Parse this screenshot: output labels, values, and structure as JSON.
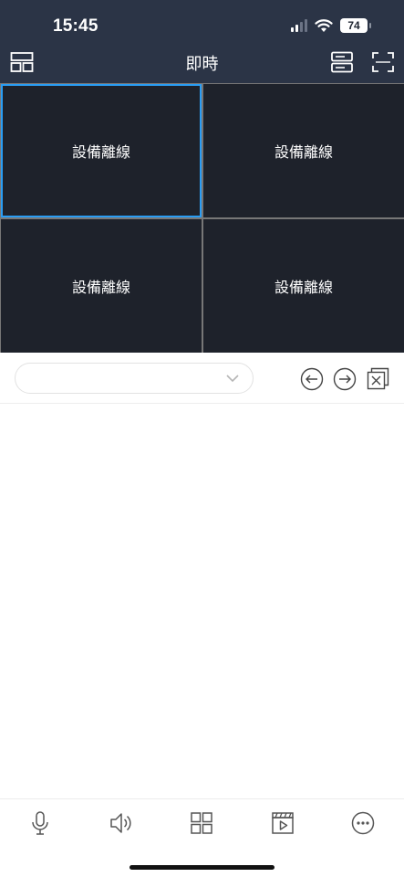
{
  "status_bar": {
    "time": "15:45",
    "battery": "74"
  },
  "header": {
    "title": "即時",
    "left_icon": "layout-icon",
    "right_icons": [
      "device-list-icon",
      "fullscreen-icon"
    ]
  },
  "video_grid": {
    "cells": [
      {
        "label": "設備離線",
        "selected": true
      },
      {
        "label": "設備離線",
        "selected": false
      },
      {
        "label": "設備離線",
        "selected": false
      },
      {
        "label": "設備離線",
        "selected": false
      }
    ]
  },
  "controls": {
    "dropdown_value": "",
    "icons": [
      "arrow-left-circle-icon",
      "arrow-right-circle-icon",
      "close-all-icon"
    ]
  },
  "bottom_toolbar": {
    "icons": [
      "microphone-icon",
      "speaker-icon",
      "grid-layout-icon",
      "playback-icon",
      "more-icon"
    ]
  },
  "colors": {
    "header_bg": "#2b3446",
    "cell_bg": "#1e222b",
    "selected_border": "#2a9df4"
  }
}
